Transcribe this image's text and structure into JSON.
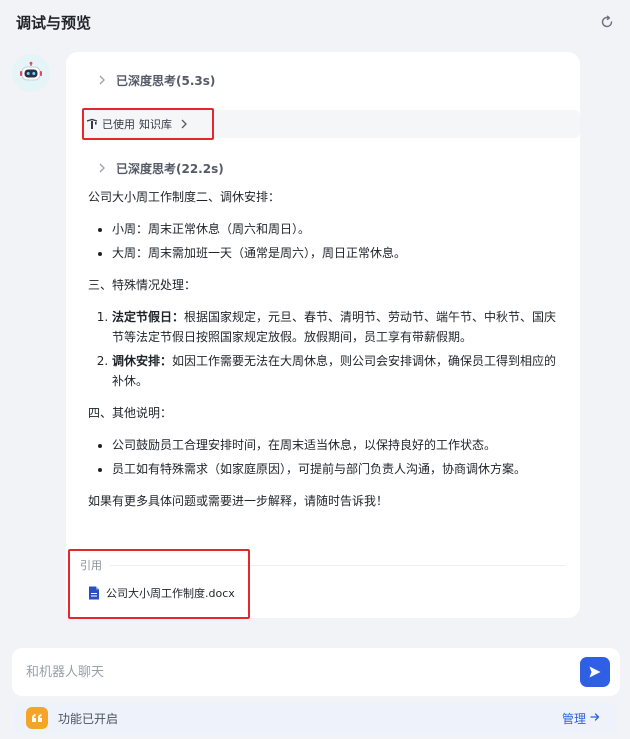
{
  "header": {
    "title": "调试与预览"
  },
  "message": {
    "think_1": "已深度思考(5.3s)",
    "kb": {
      "prefix": "已使用",
      "name": "知识库"
    },
    "think_2": "已深度思考(22.2s)",
    "intro": "公司大小周工作制度二、调休安排：",
    "rest_items": [
      "小周：周末正常休息（周六和周日）。",
      "大周：周末需加班一天（通常是周六），周日正常休息。"
    ],
    "special_heading": "三、特殊情况处理：",
    "special_items": [
      {
        "title": "法定节假日：",
        "text": "根据国家规定，元旦、春节、清明节、劳动节、端午节、中秋节、国庆节等法定节假日按照国家规定放假。放假期间，员工享有带薪假期。"
      },
      {
        "title": "调休安排：",
        "text": "如因工作需要无法在大周休息，则公司会安排调休，确保员工得到相应的补休。"
      }
    ],
    "other_heading": "四、其他说明：",
    "other_items": [
      "公司鼓励员工合理安排时间，在周末适当休息，以保持良好的工作状态。",
      "员工如有特殊需求（如家庭原因），可提前与部门负责人沟通，协商调休方案。"
    ],
    "closing": "如果有更多具体问题或需要进一步解释，请随时告诉我！",
    "reference": {
      "label": "引用",
      "file": "公司大小周工作制度.docx"
    }
  },
  "chat": {
    "placeholder": "和机器人聊天",
    "value": ""
  },
  "feature_bar": {
    "status": "功能已开启",
    "manage": "管理"
  },
  "colors": {
    "accent": "#2f5fe3",
    "highlight": "#e5262a",
    "feature": "#f5a42a"
  }
}
